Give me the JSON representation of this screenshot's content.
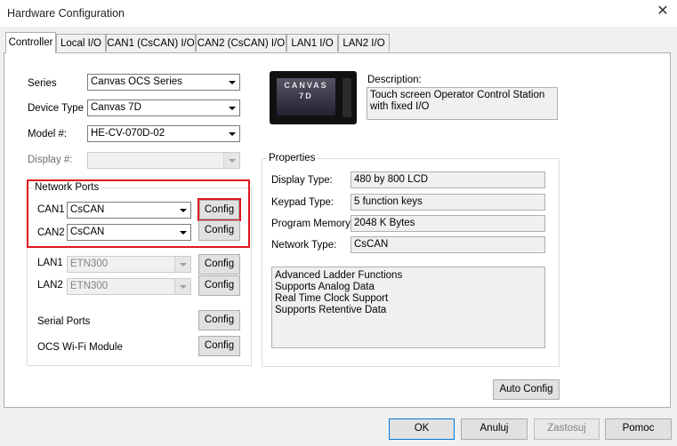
{
  "window": {
    "title": "Hardware Configuration"
  },
  "tabs": [
    {
      "label": "Controller",
      "active": true
    },
    {
      "label": "Local I/O"
    },
    {
      "label": "CAN1 (CsCAN) I/O"
    },
    {
      "label": "CAN2 (CsCAN) I/O"
    },
    {
      "label": "LAN1 I/O"
    },
    {
      "label": "LAN2 I/O"
    }
  ],
  "controller": {
    "series": {
      "label": "Series",
      "value": "Canvas OCS Series"
    },
    "device_type": {
      "label": "Device Type",
      "value": "Canvas 7D"
    },
    "model": {
      "label": "Model #:",
      "value": "HE-CV-070D-02"
    },
    "display": {
      "label": "Display #:",
      "value": ""
    }
  },
  "network_ports": {
    "title": "Network Ports",
    "can1": {
      "label": "CAN1",
      "value": "CsCAN",
      "button": "Config"
    },
    "can2": {
      "label": "CAN2",
      "value": "CsCAN",
      "button": "Config"
    },
    "lan1": {
      "label": "LAN1",
      "value": "ETN300",
      "button": "Config"
    },
    "lan2": {
      "label": "LAN2",
      "value": "ETN300",
      "button": "Config"
    },
    "serial": {
      "label": "Serial Ports",
      "button": "Config"
    },
    "wifi": {
      "label": "OCS Wi-Fi Module",
      "button": "Config"
    }
  },
  "device_image": {
    "brand_line1": "CANVAS",
    "brand_line2": "7D"
  },
  "description": {
    "label": "Description:",
    "text": "Touch screen Operator Control Station with fixed I/O"
  },
  "properties": {
    "title": "Properties",
    "display_type": {
      "label": "Display Type:",
      "value": "480 by 800 LCD"
    },
    "keypad_type": {
      "label": "Keypad Type:",
      "value": "5 function keys"
    },
    "program_memory": {
      "label": "Program Memory:",
      "value": "2048 K Bytes"
    },
    "network_type": {
      "label": "Network Type:",
      "value": "CsCAN"
    },
    "features": [
      "Advanced Ladder Functions",
      "Supports Analog Data",
      "Real Time Clock Support",
      "Supports Retentive Data"
    ]
  },
  "buttons": {
    "auto_config": "Auto Config",
    "ok": "OK",
    "cancel": "Anuluj",
    "apply": "Zastosuj",
    "help": "Pomoc"
  },
  "colors": {
    "highlight": "#e0161d",
    "focus": "#0078d7"
  }
}
